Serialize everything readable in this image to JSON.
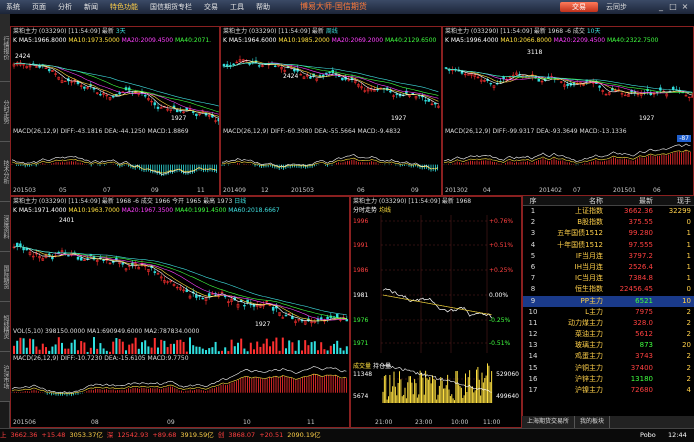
{
  "menu": [
    "系统",
    "页面",
    "分析",
    "新闻",
    "特色功能",
    "国信期货专栏",
    "交易",
    "工具",
    "帮助"
  ],
  "app_title": "博易大师-国信期货",
  "trade_button": "交易",
  "cloud": "云同步",
  "left_tabs": [
    "行情报价",
    "分时走势",
    "技术分析",
    "深度资料",
    "国际期货",
    "短线精灵",
    "沪深市场"
  ],
  "panels": {
    "p1": {
      "header": "菜粕主力 (033290) [11:54:09] 最新",
      "period": "3天",
      "ma": [
        "K  MA5:1966.8000",
        "MA10:1973.5000",
        "MA20:2009.4500",
        "MA40:2071.",
        "MA60"
      ],
      "hi": "2424",
      "lo": "1927",
      "macd": "MACD(26,12,9)  DIFF:-43.1816  DEA:-44.1250  MACD:1.8869",
      "x": [
        "201503",
        "05",
        "07",
        "09",
        "11"
      ]
    },
    "p2": {
      "header": "菜粕主力 (033290) [11:54:09] 最新",
      "period": "周线",
      "ma": [
        "K  MA5:1964.6000",
        "MA10:1985.2000",
        "MA20:2069.2000",
        "MA40:2129.6500"
      ],
      "hi": "2424",
      "lo": "1927",
      "macd": "MACD(26,12,9)  DIFF:-60.3080  DEA:-55.5664  MACD:-9.4832",
      "x": [
        "201409",
        "12",
        "201503",
        "06",
        "09"
      ]
    },
    "p3": {
      "header": "菜粕主力 (033290) [11:54:09] 最新 1968 -6 成交",
      "period": "10天",
      "ma": [
        "K  MA5:1996.4000",
        "MA10:2066.8000",
        "MA20:2209.4500",
        "MA40:2322.7500"
      ],
      "hi": "3118",
      "lo": "1927",
      "macd": "MACD(26,12,9)  DIFF:-99.9317  DEA:-93.3649  MACD:-13.1336",
      "x": [
        "201302",
        "04",
        "201402",
        "07",
        "201501",
        "06"
      ],
      "badge": "-87"
    },
    "p4": {
      "header": "菜粕主力 (033290) [11:54:09] 最新 1968 -6 成交 1966 今开 1965 最高 1973",
      "period": "日线",
      "ma": [
        "K  MA5:1971.4000",
        "MA10:1963.7000",
        "MA20:1967.3500",
        "MA40:1991.4500",
        "MA60:2018.6667"
      ],
      "hi": "2401",
      "lo": "1927",
      "vol": "VOL(5,10)  398150.0000  MA1:690949.6000  MA2:787834.0000",
      "macd": "MACD(26,12,9)  DIFF:-10.7230  DEA:-15.6105  MACD:9.7750",
      "x": [
        "201506",
        "08",
        "09",
        "10",
        "11"
      ]
    },
    "p5": {
      "header": "菜粕主力 (033290) [11:54:09] 最新 1968",
      "tab1": "分时走势",
      "tab2": "均线",
      "prices": [
        "1996",
        "1991",
        "1986",
        "1981",
        "1976",
        "1971"
      ],
      "pcts": [
        "+0.76%",
        "+0.51%",
        "+0.25%",
        "0.00%",
        "-0.25%",
        "-0.51%"
      ],
      "vol_label": "成交量",
      "oi_label": "持仓量",
      "vol_hi": "11348",
      "vol_mid": "5674",
      "oi_hi": "529060",
      "oi_lo": "499640",
      "x": [
        "21:00",
        "23:00",
        "10:00",
        "11:00"
      ]
    }
  },
  "watch": {
    "headers": [
      "序",
      "名称",
      "最新",
      "现手"
    ],
    "rows": [
      {
        "no": "1",
        "name": "上证指数",
        "last": "3662.36",
        "vol": "32299",
        "dir": "up"
      },
      {
        "no": "2",
        "name": "B股指数",
        "last": "375.55",
        "vol": "0",
        "dir": "up"
      },
      {
        "no": "3",
        "name": "五年国债1512",
        "last": "99.280",
        "vol": "1",
        "dir": "up"
      },
      {
        "no": "4",
        "name": "十年国债1512",
        "last": "97.555",
        "vol": "1",
        "dir": "up"
      },
      {
        "no": "5",
        "name": "IF当月连",
        "last": "3797.2",
        "vol": "1",
        "dir": "up"
      },
      {
        "no": "6",
        "name": "IH当月连",
        "last": "2526.4",
        "vol": "1",
        "dir": "up"
      },
      {
        "no": "7",
        "name": "IC当月连",
        "last": "7384.8",
        "vol": "1",
        "dir": "up"
      },
      {
        "no": "8",
        "name": "恒生指数",
        "last": "22456.45",
        "vol": "0",
        "dir": "up"
      },
      {
        "no": "9",
        "name": "PP主力",
        "last": "6521",
        "vol": "10",
        "dir": "dn"
      },
      {
        "no": "10",
        "name": "L主力",
        "last": "7975",
        "vol": "2",
        "dir": "up"
      },
      {
        "no": "11",
        "name": "动力煤主力",
        "last": "328.0",
        "vol": "2",
        "dir": "up"
      },
      {
        "no": "12",
        "name": "菜油主力",
        "last": "5612",
        "vol": "2",
        "dir": "up"
      },
      {
        "no": "13",
        "name": "玻璃主力",
        "last": "873",
        "vol": "20",
        "dir": "dn"
      },
      {
        "no": "14",
        "name": "鸡蛋主力",
        "last": "3743",
        "vol": "2",
        "dir": "up"
      },
      {
        "no": "15",
        "name": "沪铜主力",
        "last": "37400",
        "vol": "2",
        "dir": "up"
      },
      {
        "no": "16",
        "name": "沪锌主力",
        "last": "13180",
        "vol": "2",
        "dir": "dn"
      },
      {
        "no": "17",
        "name": "沪镍主力",
        "last": "72680",
        "vol": "4",
        "dir": "up"
      }
    ]
  },
  "bottom_tabs": [
    "上海期货交易所",
    "我的板块"
  ],
  "status": [
    {
      "t": "上",
      "c": "#ff4040"
    },
    {
      "t": "3662.36",
      "c": "#ff4040"
    },
    {
      "t": "+15.48",
      "c": "#ff4040"
    },
    {
      "t": "3053.37亿",
      "c": "#ffd04a"
    },
    {
      "t": "深",
      "c": "#ff4040"
    },
    {
      "t": "12542.93",
      "c": "#ff4040"
    },
    {
      "t": "+89.68",
      "c": "#ff4040"
    },
    {
      "t": "3919.59亿",
      "c": "#ffd04a"
    },
    {
      "t": "创",
      "c": "#ff4040"
    },
    {
      "t": "3868.07",
      "c": "#ff4040"
    },
    {
      "t": "+20.51",
      "c": "#ff4040"
    },
    {
      "t": "2090.19亿",
      "c": "#ffd04a"
    }
  ],
  "brand": "Pobo",
  "clock": "12:44"
}
